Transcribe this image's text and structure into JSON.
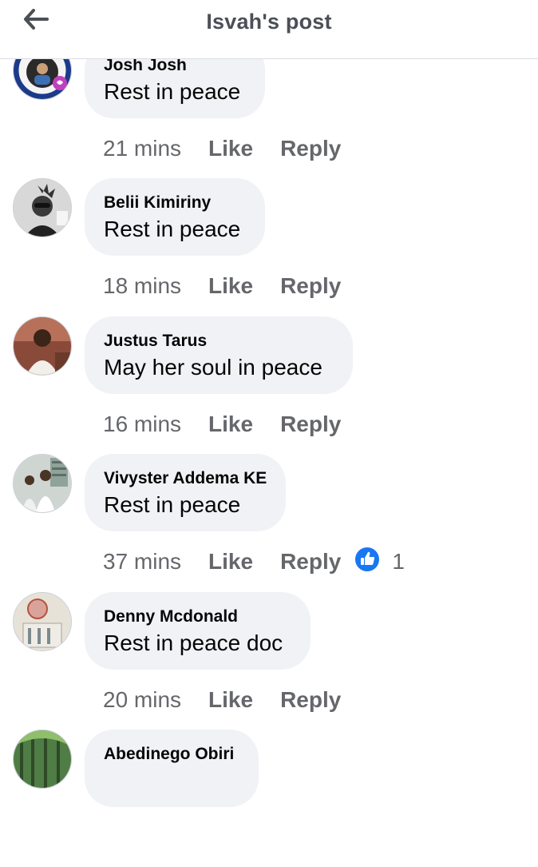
{
  "header": {
    "title": "Isvah's post"
  },
  "comments": [
    {
      "author": "Josh Josh",
      "text": "Rest in peace",
      "time": "21 mins",
      "like": "Like",
      "reply": "Reply"
    },
    {
      "author": "Belii Kimiriny",
      "text": "Rest in peace",
      "time": "18 mins",
      "like": "Like",
      "reply": "Reply"
    },
    {
      "author": "Justus Tarus",
      "text": "May her soul in peace",
      "time": "16 mins",
      "like": "Like",
      "reply": "Reply"
    },
    {
      "author": "Vivyster Addema KE",
      "text": "Rest in peace",
      "time": "37 mins",
      "like": "Like",
      "reply": "Reply",
      "reaction_icon": "thumbs-up-icon",
      "reaction_count": "1"
    },
    {
      "author": "Denny Mcdonald",
      "text": "Rest in peace doc",
      "time": "20 mins",
      "like": "Like",
      "reply": "Reply"
    },
    {
      "author": "Abedinego Obiri",
      "text": "",
      "time": "",
      "like": "",
      "reply": ""
    }
  ],
  "colors": {
    "accent": "#1877f2",
    "bubble": "#f0f2f5",
    "meta": "#65676b",
    "title": "#4b4f56"
  }
}
